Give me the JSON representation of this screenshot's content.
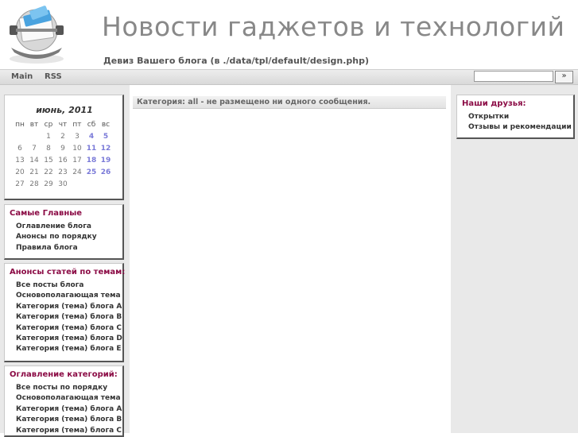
{
  "header": {
    "title": "Новости гаджетов и технологий",
    "motto": "Девиз Вашего блога (в ./data/tpl/default/design.php)"
  },
  "nav": {
    "items": [
      "Main",
      "RSS"
    ],
    "search_button": "»"
  },
  "calendar": {
    "title": "июнь, 2011",
    "weekdays": [
      "пн",
      "вт",
      "ср",
      "чт",
      "пт",
      "сб",
      "вс"
    ],
    "weeks": [
      [
        "",
        "",
        "1",
        "2",
        "3",
        "4",
        "5"
      ],
      [
        "6",
        "7",
        "8",
        "9",
        "10",
        "11",
        "12"
      ],
      [
        "13",
        "14",
        "15",
        "16",
        "17",
        "18",
        "19"
      ],
      [
        "20",
        "21",
        "22",
        "23",
        "24",
        "25",
        "26"
      ],
      [
        "27",
        "28",
        "29",
        "30",
        "",
        "",
        ""
      ]
    ]
  },
  "main_box": {
    "title": "Самые Главные",
    "items": [
      "Оглавление блога",
      "Анонсы по порядку",
      "Правила блога"
    ]
  },
  "announce_box": {
    "title": "Анонсы статей по темам:",
    "items": [
      "Все посты блога",
      "Основополагающая тема",
      "Категория (тема) блога A",
      "Категория (тема) блога B",
      "Категория (тема) блога C",
      "Категория (тема) блога D",
      "Категория (тема) блога E"
    ]
  },
  "toc_box": {
    "title": "Оглавление категорий:",
    "items": [
      "Все посты по порядку",
      "Основополагающая тема",
      "Категория (тема) блога A",
      "Категория (тема) блога B",
      "Категория (тема) блога C"
    ]
  },
  "content": {
    "notice": "Категория: all - не размещено ни одного сообщения."
  },
  "friends_box": {
    "title": "Наши друзья:",
    "items": [
      "Открытки",
      "Отзывы и рекомендации"
    ]
  },
  "colors": {
    "box_title": "#8b0b45",
    "weekend": "#7a7ad8",
    "sidebar_bg": "#e9e9e9"
  }
}
